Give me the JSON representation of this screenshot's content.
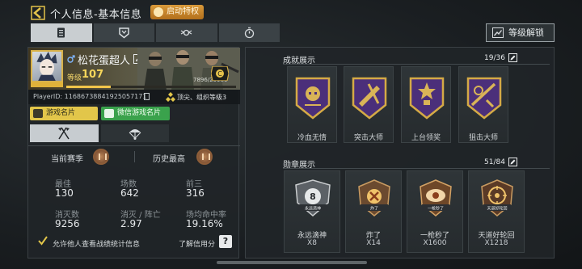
{
  "header": {
    "title": "个人信息-基本信息",
    "privilege_button": "启动特权",
    "level_unlock": "等级解锁",
    "tabs": [
      {
        "name": "tab-basic-info",
        "icon": "id-card-icon",
        "active": true
      },
      {
        "name": "tab-armory",
        "icon": "shield-icon",
        "active": false
      },
      {
        "name": "tab-honor",
        "icon": "wings-emblem-icon",
        "active": false
      },
      {
        "name": "tab-timer",
        "icon": "stopwatch-icon",
        "active": false
      }
    ]
  },
  "profile": {
    "name": "松花蛋超人",
    "level_label": "等级",
    "level": "107",
    "xp_text": "7896/29980",
    "xp_fraction": 0.263,
    "player_id": "PlayerID: 11686738841925057171",
    "org_text": "顶尖、组织等级3"
  },
  "cards": {
    "game_card": "游戏名片",
    "wechat_card": "微信游戏名片"
  },
  "season": {
    "current_label": "当前赛季",
    "history_label": "历史最高"
  },
  "stats": {
    "best_label": "最佳",
    "best_value": "130",
    "matches_label": "场数",
    "matches_value": "642",
    "top3_label": "前三",
    "top3_value": "316",
    "kills_label": "消灭数",
    "kills_value": "9256",
    "kd_label": "消灭 / 阵亡",
    "kd_value": "2.97",
    "hitrate_label": "场均命中率",
    "hitrate_value": "19.16%"
  },
  "footer": {
    "allow_text": "允许他人查看战绩统计信息",
    "credit_text": "了解信用分",
    "help": "?"
  },
  "achievements": {
    "title": "成就展示",
    "count": "19/36",
    "items": [
      {
        "name": "冷血无情"
      },
      {
        "name": "突击大师"
      },
      {
        "name": "上台领奖"
      },
      {
        "name": "狙击大师"
      }
    ]
  },
  "medals": {
    "title": "勋章展示",
    "count": "51/84",
    "items": [
      {
        "name": "永远滴神",
        "count": "X8",
        "badge": "永远滴神"
      },
      {
        "name": "炸了",
        "count": "X14",
        "badge": "炸了"
      },
      {
        "name": "一枪秒了",
        "count": "X1600",
        "badge": "一枪秒了"
      },
      {
        "name": "天道好轮回",
        "count": "X1218",
        "badge": "天道好轮回"
      }
    ]
  },
  "colors": {
    "accent_gold": "#e2c64a",
    "wechat_green": "#3aa24c",
    "achievement_purple": "#4b2f7a"
  }
}
